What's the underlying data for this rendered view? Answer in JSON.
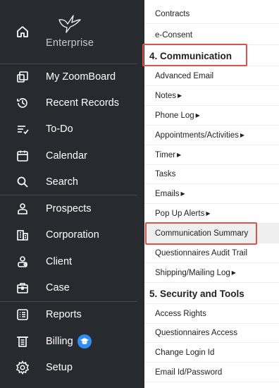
{
  "brand": {
    "name": "Enterprise",
    "home_icon": "home-icon",
    "logo_icon": "hummingbird-logo-icon"
  },
  "sidebar": {
    "items": [
      {
        "id": "my-zoomboard",
        "label": "My ZoomBoard",
        "icon": "dashboard-icon"
      },
      {
        "id": "recent-records",
        "label": "Recent Records",
        "icon": "history-icon"
      },
      {
        "id": "to-do",
        "label": "To-Do",
        "icon": "checklist-icon"
      },
      {
        "id": "calendar",
        "label": "Calendar",
        "icon": "calendar-icon"
      },
      {
        "id": "search",
        "label": "Search",
        "icon": "search-icon"
      },
      {
        "id": "prospects",
        "label": "Prospects",
        "icon": "person-icon"
      },
      {
        "id": "corporation",
        "label": "Corporation",
        "icon": "building-icon"
      },
      {
        "id": "client",
        "label": "Client",
        "icon": "client-icon"
      },
      {
        "id": "case",
        "label": "Case",
        "icon": "briefcase-icon"
      },
      {
        "id": "reports",
        "label": "Reports",
        "icon": "report-icon"
      },
      {
        "id": "billing",
        "label": "Billing",
        "icon": "billing-icon",
        "badge_icon": "graduation-cap-icon"
      },
      {
        "id": "setup",
        "label": "Setup",
        "icon": "gear-icon"
      }
    ]
  },
  "panel": {
    "items": [
      {
        "type": "item",
        "label": "Contracts"
      },
      {
        "type": "item",
        "label": "e-Consent"
      },
      {
        "type": "section",
        "label": "4. Communication",
        "boxed": true
      },
      {
        "type": "item",
        "label": "Advanced Email"
      },
      {
        "type": "item",
        "label": "Notes",
        "submenu": true
      },
      {
        "type": "item",
        "label": "Phone Log",
        "submenu": true
      },
      {
        "type": "item",
        "label": "Appointments/Activities",
        "submenu": true
      },
      {
        "type": "item",
        "label": "Timer",
        "submenu": true
      },
      {
        "type": "item",
        "label": "Tasks"
      },
      {
        "type": "item",
        "label": "Emails",
        "submenu": true
      },
      {
        "type": "item",
        "label": "Pop Up Alerts",
        "submenu": true
      },
      {
        "type": "item",
        "label": "Communication Summary",
        "highlight": true,
        "boxed": true
      },
      {
        "type": "item",
        "label": "Questionnaires Audit Trail"
      },
      {
        "type": "item",
        "label": "Shipping/Mailing Log",
        "submenu": true
      },
      {
        "type": "section",
        "label": "5. Security and Tools"
      },
      {
        "type": "item",
        "label": "Access Rights"
      },
      {
        "type": "item",
        "label": "Questionnaires Access"
      },
      {
        "type": "item",
        "label": "Change Login Id"
      },
      {
        "type": "item",
        "label": "Email Id/Password"
      }
    ]
  },
  "colors": {
    "sidebar_bg": "#272b30",
    "highlight_bg": "#efefef",
    "annotation_red": "#d9534f",
    "badge_blue": "#2f8df5"
  }
}
